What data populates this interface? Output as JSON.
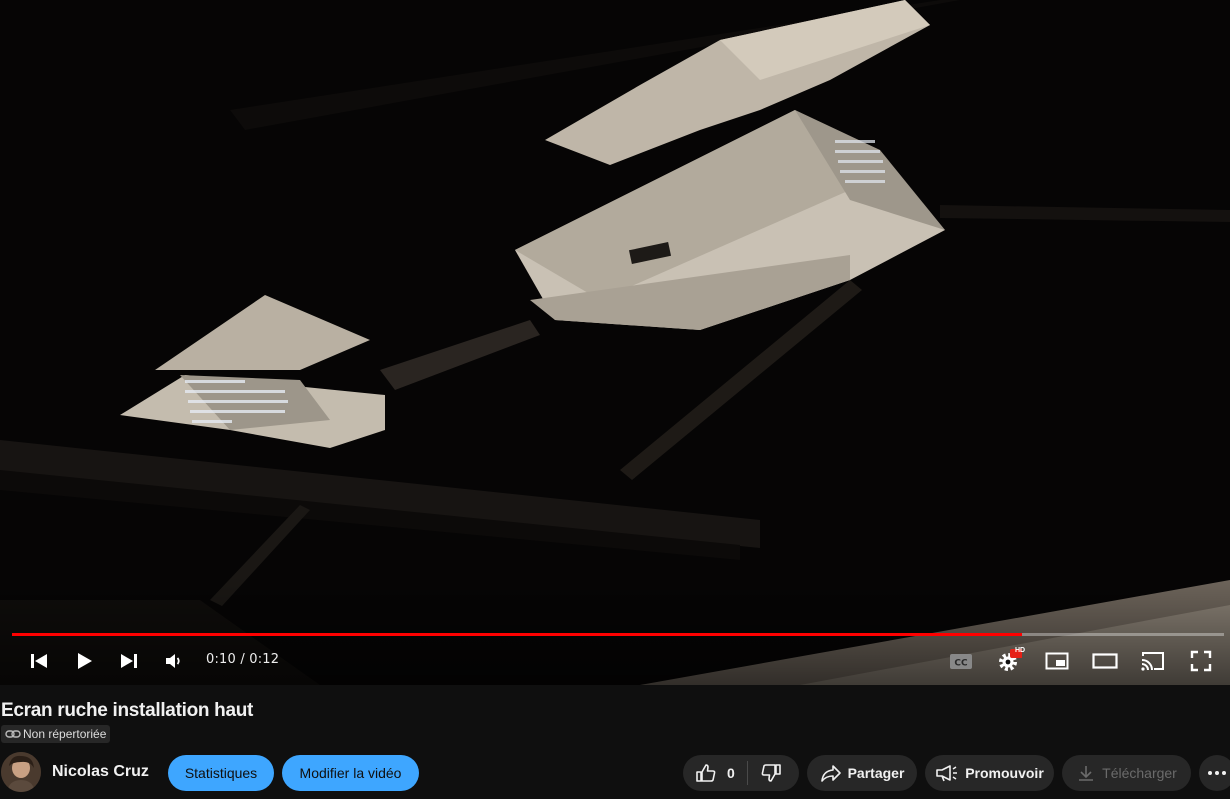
{
  "player": {
    "time_text": "0:10 / 0:12",
    "progress_fraction": 0.833,
    "progress_color": "#ff0000",
    "settings_badge": "HD",
    "icons": [
      "previous-icon",
      "play-icon",
      "next-icon",
      "volume-icon",
      "captions-icon",
      "settings-icon",
      "miniplayer-icon",
      "theater-icon",
      "cast-icon",
      "fullscreen-icon"
    ]
  },
  "video": {
    "title": "Ecran ruche installation haut",
    "visibility_label": "Non répertoriée"
  },
  "channel": {
    "name": "Nicolas Cruz"
  },
  "actions": {
    "stats_label": "Statistiques",
    "edit_label": "Modifier la vidéo",
    "like_count": "0",
    "share_label": "Partager",
    "promote_label": "Promouvoir",
    "download_label": "Télécharger"
  },
  "colors": {
    "accent_blue": "#3ea6ff",
    "background": "#0f0f0f",
    "pill_gray": "#272727"
  }
}
